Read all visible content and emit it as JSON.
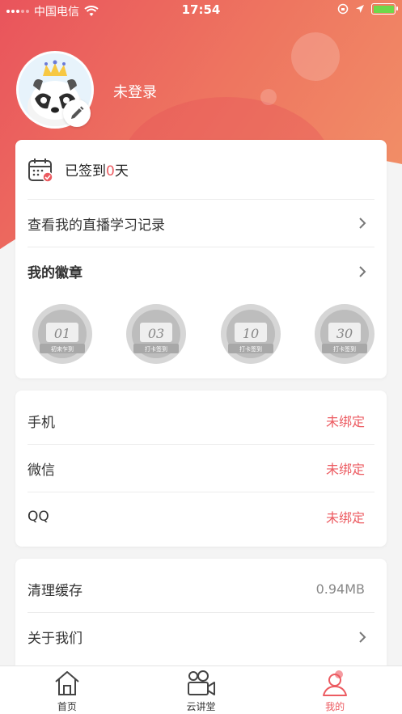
{
  "status_bar": {
    "carrier": "中国电信",
    "time": "17:54"
  },
  "profile": {
    "login_status": "未登录"
  },
  "checkin": {
    "prefix": "已签到",
    "count": "0",
    "suffix": "天"
  },
  "menu": {
    "live_record": "查看我的直播学习记录",
    "my_badges": "我的徽章"
  },
  "badges": [
    {
      "number": "01",
      "caption": "初来乍到"
    },
    {
      "number": "03",
      "caption": "打卡签到"
    },
    {
      "number": "10",
      "caption": "打卡签到"
    },
    {
      "number": "30",
      "caption": "打卡签到"
    }
  ],
  "bindings": [
    {
      "label": "手机",
      "status": "未绑定"
    },
    {
      "label": "微信",
      "status": "未绑定"
    },
    {
      "label": "QQ",
      "status": "未绑定"
    }
  ],
  "settings": {
    "clear_cache": "清理缓存",
    "cache_size": "0.94MB",
    "about_us": "关于我们"
  },
  "tabbar": [
    {
      "label": "首页",
      "icon": "home-icon"
    },
    {
      "label": "云讲堂",
      "icon": "video-camera-icon"
    },
    {
      "label": "我的",
      "icon": "user-icon"
    }
  ],
  "colors": {
    "accent": "#ec5b61",
    "header_gradient_start": "#e9545c",
    "header_gradient_end": "#f3996a"
  }
}
